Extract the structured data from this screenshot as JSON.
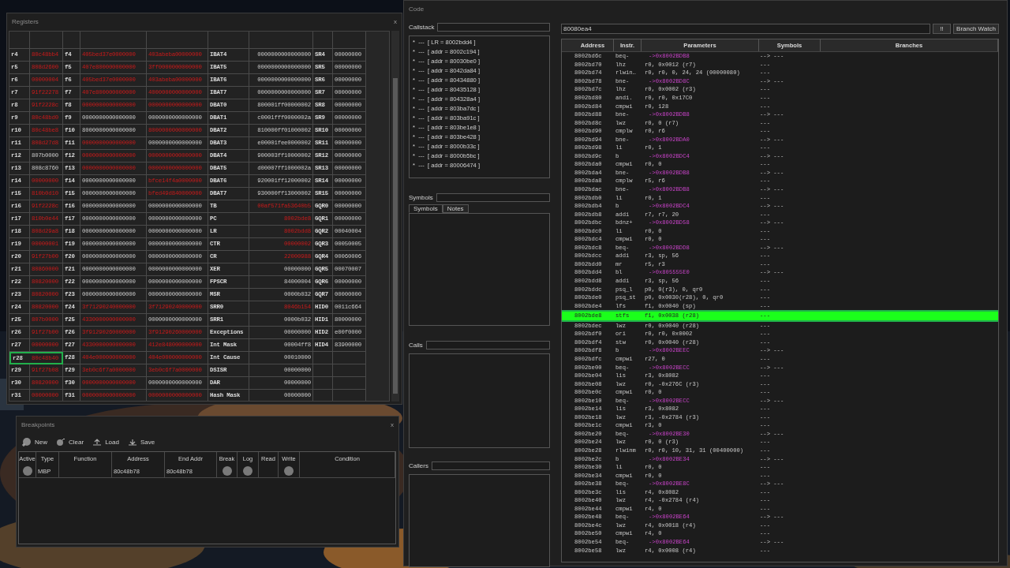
{
  "registers": {
    "title": "Registers",
    "close": "x",
    "rows": [
      {
        "selected": false,
        "cells": [
          {
            "kind": "name",
            "text": "r4"
          },
          {
            "kind": "value",
            "text": "80c48bb4",
            "changed": true
          },
          {
            "kind": "name",
            "text": "f4"
          },
          {
            "kind": "value",
            "text": "405bed37e0000000",
            "changed": true
          },
          {
            "kind": "value",
            "text": "403abeba00000000",
            "changed": true
          },
          {
            "kind": "name",
            "text": "IBAT4"
          },
          {
            "kind": "value",
            "text": "0000000000000000",
            "changed": false
          },
          {
            "kind": "name",
            "text": "SR4"
          },
          {
            "kind": "value",
            "text": "00000000",
            "changed": false
          }
        ]
      },
      {
        "selected": false,
        "cells": [
          {
            "kind": "name",
            "text": "r5"
          },
          {
            "kind": "value",
            "text": "808d2600",
            "changed": true
          },
          {
            "kind": "name",
            "text": "f5"
          },
          {
            "kind": "value",
            "text": "407e800000000000",
            "changed": true
          },
          {
            "kind": "value",
            "text": "3ff0000000000000",
            "changed": true
          },
          {
            "kind": "name",
            "text": "IBAT5"
          },
          {
            "kind": "value",
            "text": "0000000000000000",
            "changed": false
          },
          {
            "kind": "name",
            "text": "SR5"
          },
          {
            "kind": "value",
            "text": "00000000",
            "changed": false
          }
        ]
      },
      {
        "selected": false,
        "cells": [
          {
            "kind": "name",
            "text": "r6"
          },
          {
            "kind": "value",
            "text": "00000004",
            "changed": true
          },
          {
            "kind": "name",
            "text": "f6"
          },
          {
            "kind": "value",
            "text": "405bed37e0000000",
            "changed": true
          },
          {
            "kind": "value",
            "text": "403abeba00000000",
            "changed": true
          },
          {
            "kind": "name",
            "text": "IBAT6"
          },
          {
            "kind": "value",
            "text": "0000000000000000",
            "changed": false
          },
          {
            "kind": "name",
            "text": "SR6"
          },
          {
            "kind": "value",
            "text": "00000000",
            "changed": false
          }
        ]
      },
      {
        "selected": false,
        "cells": [
          {
            "kind": "name",
            "text": "r7"
          },
          {
            "kind": "value",
            "text": "91f22278",
            "changed": true
          },
          {
            "kind": "name",
            "text": "f7"
          },
          {
            "kind": "value",
            "text": "407e800000000000",
            "changed": true
          },
          {
            "kind": "value",
            "text": "4000000000000000",
            "changed": true
          },
          {
            "kind": "name",
            "text": "IBAT7"
          },
          {
            "kind": "value",
            "text": "0000000000000000",
            "changed": false
          },
          {
            "kind": "name",
            "text": "SR7"
          },
          {
            "kind": "value",
            "text": "00000000",
            "changed": false
          }
        ]
      },
      {
        "selected": false,
        "cells": [
          {
            "kind": "name",
            "text": "r8"
          },
          {
            "kind": "value",
            "text": "91f2228c",
            "changed": true
          },
          {
            "kind": "name",
            "text": "f8"
          },
          {
            "kind": "value",
            "text": "0000000000000000",
            "changed": true
          },
          {
            "kind": "value",
            "text": "0000000000000000",
            "changed": true
          },
          {
            "kind": "name",
            "text": "DBAT0"
          },
          {
            "kind": "value",
            "text": "800001ff00000002",
            "changed": false
          },
          {
            "kind": "name",
            "text": "SR8"
          },
          {
            "kind": "value",
            "text": "00000000",
            "changed": false
          }
        ]
      },
      {
        "selected": false,
        "cells": [
          {
            "kind": "name",
            "text": "r9"
          },
          {
            "kind": "value",
            "text": "80c48bd0",
            "changed": true
          },
          {
            "kind": "name",
            "text": "f9"
          },
          {
            "kind": "value",
            "text": "0000000000000000",
            "changed": false
          },
          {
            "kind": "value",
            "text": "0000000000000000",
            "changed": false
          },
          {
            "kind": "name",
            "text": "DBAT1"
          },
          {
            "kind": "value",
            "text": "c0001fff0000002a",
            "changed": false
          },
          {
            "kind": "name",
            "text": "SR9"
          },
          {
            "kind": "value",
            "text": "00000000",
            "changed": false
          }
        ]
      },
      {
        "selected": false,
        "cells": [
          {
            "kind": "name",
            "text": "r10"
          },
          {
            "kind": "value",
            "text": "80c48be8",
            "changed": true
          },
          {
            "kind": "name",
            "text": "f10"
          },
          {
            "kind": "value",
            "text": "8000000000000000",
            "changed": false
          },
          {
            "kind": "value",
            "text": "8000000000000000",
            "changed": true
          },
          {
            "kind": "name",
            "text": "DBAT2"
          },
          {
            "kind": "value",
            "text": "810000ff01000002",
            "changed": false
          },
          {
            "kind": "name",
            "text": "SR10"
          },
          {
            "kind": "value",
            "text": "00000000",
            "changed": false
          }
        ]
      },
      {
        "selected": false,
        "cells": [
          {
            "kind": "name",
            "text": "r11"
          },
          {
            "kind": "value",
            "text": "808d27d8",
            "changed": true
          },
          {
            "kind": "name",
            "text": "f11"
          },
          {
            "kind": "value",
            "text": "0000000000000000",
            "changed": true
          },
          {
            "kind": "value",
            "text": "0000000000000000",
            "changed": false
          },
          {
            "kind": "name",
            "text": "DBAT3"
          },
          {
            "kind": "value",
            "text": "e00001fee0000002",
            "changed": false
          },
          {
            "kind": "name",
            "text": "SR11"
          },
          {
            "kind": "value",
            "text": "00000000",
            "changed": false
          }
        ]
      },
      {
        "selected": false,
        "cells": [
          {
            "kind": "name",
            "text": "r12"
          },
          {
            "kind": "value",
            "text": "807b0000",
            "changed": false
          },
          {
            "kind": "name",
            "text": "f12"
          },
          {
            "kind": "value",
            "text": "0000000000000000",
            "changed": true
          },
          {
            "kind": "value",
            "text": "0000000000000000",
            "changed": true
          },
          {
            "kind": "name",
            "text": "DBAT4"
          },
          {
            "kind": "value",
            "text": "900003ff10000002",
            "changed": false
          },
          {
            "kind": "name",
            "text": "SR12"
          },
          {
            "kind": "value",
            "text": "00000000",
            "changed": false
          }
        ]
      },
      {
        "selected": false,
        "cells": [
          {
            "kind": "name",
            "text": "r13"
          },
          {
            "kind": "value",
            "text": "808c8760",
            "changed": false
          },
          {
            "kind": "name",
            "text": "f13"
          },
          {
            "kind": "value",
            "text": "0000000000000000",
            "changed": true
          },
          {
            "kind": "value",
            "text": "0000000000000000",
            "changed": true
          },
          {
            "kind": "name",
            "text": "DBAT5"
          },
          {
            "kind": "value",
            "text": "d00007ff1000002a",
            "changed": false
          },
          {
            "kind": "name",
            "text": "SR13"
          },
          {
            "kind": "value",
            "text": "00000000",
            "changed": false
          }
        ]
      },
      {
        "selected": false,
        "cells": [
          {
            "kind": "name",
            "text": "r14"
          },
          {
            "kind": "value",
            "text": "00000000",
            "changed": true
          },
          {
            "kind": "name",
            "text": "f14"
          },
          {
            "kind": "value",
            "text": "0000000000000000",
            "changed": false
          },
          {
            "kind": "value",
            "text": "bfce14f4a0000000",
            "changed": true
          },
          {
            "kind": "name",
            "text": "DBAT6"
          },
          {
            "kind": "value",
            "text": "920001ff12000002",
            "changed": false
          },
          {
            "kind": "name",
            "text": "SR14"
          },
          {
            "kind": "value",
            "text": "00000000",
            "changed": false
          }
        ]
      },
      {
        "selected": false,
        "cells": [
          {
            "kind": "name",
            "text": "r15"
          },
          {
            "kind": "value",
            "text": "810b0d10",
            "changed": true
          },
          {
            "kind": "name",
            "text": "f15"
          },
          {
            "kind": "value",
            "text": "0000000000000000",
            "changed": false
          },
          {
            "kind": "value",
            "text": "bfed49d840000000",
            "changed": true
          },
          {
            "kind": "name",
            "text": "DBAT7"
          },
          {
            "kind": "value",
            "text": "930000ff13000002",
            "changed": false
          },
          {
            "kind": "name",
            "text": "SR15"
          },
          {
            "kind": "value",
            "text": "00000000",
            "changed": false
          }
        ]
      },
      {
        "selected": false,
        "cells": [
          {
            "kind": "name",
            "text": "r16"
          },
          {
            "kind": "value",
            "text": "91f2228c",
            "changed": true
          },
          {
            "kind": "name",
            "text": "f16"
          },
          {
            "kind": "value",
            "text": "0000000000000000",
            "changed": false
          },
          {
            "kind": "value",
            "text": "0000000000000000",
            "changed": false
          },
          {
            "kind": "name",
            "text": "TB"
          },
          {
            "kind": "value",
            "text": "00af571fa53640b5",
            "changed": true
          },
          {
            "kind": "name",
            "text": "GQR0"
          },
          {
            "kind": "value",
            "text": "00000000",
            "changed": false
          }
        ]
      },
      {
        "selected": false,
        "cells": [
          {
            "kind": "name",
            "text": "r17"
          },
          {
            "kind": "value",
            "text": "810b0e44",
            "changed": true
          },
          {
            "kind": "name",
            "text": "f17"
          },
          {
            "kind": "value",
            "text": "0000000000000000",
            "changed": false
          },
          {
            "kind": "value",
            "text": "0000000000000000",
            "changed": false
          },
          {
            "kind": "name",
            "text": "PC"
          },
          {
            "kind": "value",
            "text": "8002bde8",
            "changed": true
          },
          {
            "kind": "name",
            "text": "GQR1"
          },
          {
            "kind": "value",
            "text": "00000000",
            "changed": false
          }
        ]
      },
      {
        "selected": false,
        "cells": [
          {
            "kind": "name",
            "text": "r18"
          },
          {
            "kind": "value",
            "text": "808d29a8",
            "changed": true
          },
          {
            "kind": "name",
            "text": "f18"
          },
          {
            "kind": "value",
            "text": "0000000000000000",
            "changed": false
          },
          {
            "kind": "value",
            "text": "0000000000000000",
            "changed": false
          },
          {
            "kind": "name",
            "text": "LR"
          },
          {
            "kind": "value",
            "text": "8002bdd8",
            "changed": true
          },
          {
            "kind": "name",
            "text": "GQR2"
          },
          {
            "kind": "value",
            "text": "00040004",
            "changed": false
          }
        ]
      },
      {
        "selected": false,
        "cells": [
          {
            "kind": "name",
            "text": "r19"
          },
          {
            "kind": "value",
            "text": "00000001",
            "changed": true
          },
          {
            "kind": "name",
            "text": "f19"
          },
          {
            "kind": "value",
            "text": "0000000000000000",
            "changed": false
          },
          {
            "kind": "value",
            "text": "0000000000000000",
            "changed": false
          },
          {
            "kind": "name",
            "text": "CTR"
          },
          {
            "kind": "value",
            "text": "00000002",
            "changed": true
          },
          {
            "kind": "name",
            "text": "GQR3"
          },
          {
            "kind": "value",
            "text": "00050005",
            "changed": false
          }
        ]
      },
      {
        "selected": false,
        "cells": [
          {
            "kind": "name",
            "text": "r20"
          },
          {
            "kind": "value",
            "text": "91f27b00",
            "changed": true
          },
          {
            "kind": "name",
            "text": "f20"
          },
          {
            "kind": "value",
            "text": "0000000000000000",
            "changed": false
          },
          {
            "kind": "value",
            "text": "0000000000000000",
            "changed": false
          },
          {
            "kind": "name",
            "text": "CR"
          },
          {
            "kind": "value",
            "text": "22000988",
            "changed": true
          },
          {
            "kind": "name",
            "text": "GQR4"
          },
          {
            "kind": "value",
            "text": "00060006",
            "changed": false
          }
        ]
      },
      {
        "selected": false,
        "cells": [
          {
            "kind": "name",
            "text": "r21"
          },
          {
            "kind": "value",
            "text": "80860000",
            "changed": true
          },
          {
            "kind": "name",
            "text": "f21"
          },
          {
            "kind": "value",
            "text": "0000000000000000",
            "changed": false
          },
          {
            "kind": "value",
            "text": "0000000000000000",
            "changed": false
          },
          {
            "kind": "name",
            "text": "XER"
          },
          {
            "kind": "value",
            "text": "00000000",
            "changed": false
          },
          {
            "kind": "name",
            "text": "GQR5"
          },
          {
            "kind": "value",
            "text": "00070007",
            "changed": false
          }
        ]
      },
      {
        "selected": false,
        "cells": [
          {
            "kind": "name",
            "text": "r22"
          },
          {
            "kind": "value",
            "text": "80820000",
            "changed": true
          },
          {
            "kind": "name",
            "text": "f22"
          },
          {
            "kind": "value",
            "text": "0000000000000000",
            "changed": false
          },
          {
            "kind": "value",
            "text": "0000000000000000",
            "changed": false
          },
          {
            "kind": "name",
            "text": "FPSCR"
          },
          {
            "kind": "value",
            "text": "84000004",
            "changed": false
          },
          {
            "kind": "name",
            "text": "GQR6"
          },
          {
            "kind": "value",
            "text": "00000000",
            "changed": false
          }
        ]
      },
      {
        "selected": false,
        "cells": [
          {
            "kind": "name",
            "text": "r23"
          },
          {
            "kind": "value",
            "text": "80820000",
            "changed": true
          },
          {
            "kind": "name",
            "text": "f23"
          },
          {
            "kind": "value",
            "text": "0000000000000000",
            "changed": false
          },
          {
            "kind": "value",
            "text": "0000000000000000",
            "changed": false
          },
          {
            "kind": "name",
            "text": "MSR"
          },
          {
            "kind": "value",
            "text": "0000b032",
            "changed": false
          },
          {
            "kind": "name",
            "text": "GQR7"
          },
          {
            "kind": "value",
            "text": "00000000",
            "changed": false
          }
        ]
      },
      {
        "selected": false,
        "cells": [
          {
            "kind": "name",
            "text": "r24"
          },
          {
            "kind": "value",
            "text": "80820000",
            "changed": true
          },
          {
            "kind": "name",
            "text": "f24"
          },
          {
            "kind": "value",
            "text": "3f71290240000000",
            "changed": true
          },
          {
            "kind": "value",
            "text": "3f71290240000000",
            "changed": true
          },
          {
            "kind": "name",
            "text": "SRR0"
          },
          {
            "kind": "value",
            "text": "8046b154",
            "changed": true
          },
          {
            "kind": "name",
            "text": "HID0"
          },
          {
            "kind": "value",
            "text": "0011c664",
            "changed": false
          }
        ]
      },
      {
        "selected": false,
        "cells": [
          {
            "kind": "name",
            "text": "r25"
          },
          {
            "kind": "value",
            "text": "807b0000",
            "changed": true
          },
          {
            "kind": "name",
            "text": "f25"
          },
          {
            "kind": "value",
            "text": "4330000000000000",
            "changed": true
          },
          {
            "kind": "value",
            "text": "0000000000000000",
            "changed": false
          },
          {
            "kind": "name",
            "text": "SRR1"
          },
          {
            "kind": "value",
            "text": "0000b032",
            "changed": false
          },
          {
            "kind": "name",
            "text": "HID1"
          },
          {
            "kind": "value",
            "text": "80000000",
            "changed": false
          }
        ]
      },
      {
        "selected": false,
        "cells": [
          {
            "kind": "name",
            "text": "r26"
          },
          {
            "kind": "value",
            "text": "91f27b00",
            "changed": true
          },
          {
            "kind": "name",
            "text": "f26"
          },
          {
            "kind": "value",
            "text": "3f91290260000000",
            "changed": true
          },
          {
            "kind": "value",
            "text": "3f91290260000000",
            "changed": true
          },
          {
            "kind": "name",
            "text": "Exceptions"
          },
          {
            "kind": "value",
            "text": "00000000",
            "changed": false
          },
          {
            "kind": "name",
            "text": "HID2"
          },
          {
            "kind": "value",
            "text": "e00f0000",
            "changed": false
          }
        ]
      },
      {
        "selected": false,
        "cells": [
          {
            "kind": "name",
            "text": "r27"
          },
          {
            "kind": "value",
            "text": "00000000",
            "changed": true
          },
          {
            "kind": "name",
            "text": "f27"
          },
          {
            "kind": "value",
            "text": "4330000000000000",
            "changed": true
          },
          {
            "kind": "value",
            "text": "412e848000000000",
            "changed": true
          },
          {
            "kind": "name",
            "text": "Int Mask"
          },
          {
            "kind": "value",
            "text": "00004ff8",
            "changed": false
          },
          {
            "kind": "name",
            "text": "HID4"
          },
          {
            "kind": "value",
            "text": "83900000",
            "changed": false
          }
        ]
      },
      {
        "selected": true,
        "cells": [
          {
            "kind": "name",
            "text": "r28"
          },
          {
            "kind": "value",
            "text": "80c48b40",
            "changed": true
          },
          {
            "kind": "name",
            "text": "f28"
          },
          {
            "kind": "value",
            "text": "404e000000000000",
            "changed": true
          },
          {
            "kind": "value",
            "text": "404e000000000000",
            "changed": true
          },
          {
            "kind": "name",
            "text": "Int Cause"
          },
          {
            "kind": "value",
            "text": "00010000",
            "changed": false
          }
        ]
      },
      {
        "selected": false,
        "cells": [
          {
            "kind": "name",
            "text": "r29"
          },
          {
            "kind": "value",
            "text": "91f27b08",
            "changed": true
          },
          {
            "kind": "name",
            "text": "f29"
          },
          {
            "kind": "value",
            "text": "3eb0c6f7a0000000",
            "changed": true
          },
          {
            "kind": "value",
            "text": "3eb0c6f7a0000000",
            "changed": true
          },
          {
            "kind": "name",
            "text": "DSISR"
          },
          {
            "kind": "value",
            "text": "00000000",
            "changed": false
          }
        ]
      },
      {
        "selected": false,
        "cells": [
          {
            "kind": "name",
            "text": "r30"
          },
          {
            "kind": "value",
            "text": "80820000",
            "changed": true
          },
          {
            "kind": "name",
            "text": "f30"
          },
          {
            "kind": "value",
            "text": "0000000000000000",
            "changed": true
          },
          {
            "kind": "value",
            "text": "0000000000000000",
            "changed": false
          },
          {
            "kind": "name",
            "text": "DAR"
          },
          {
            "kind": "value",
            "text": "00000000",
            "changed": false
          }
        ]
      },
      {
        "selected": false,
        "cells": [
          {
            "kind": "name",
            "text": "r31"
          },
          {
            "kind": "value",
            "text": "00000000",
            "changed": true
          },
          {
            "kind": "name",
            "text": "f31"
          },
          {
            "kind": "value",
            "text": "0000000000000000",
            "changed": true
          },
          {
            "kind": "value",
            "text": "0000000000000000",
            "changed": true
          },
          {
            "kind": "name",
            "text": "Hash Mask"
          },
          {
            "kind": "value",
            "text": "00000000",
            "changed": false
          }
        ]
      }
    ]
  },
  "breakpoints": {
    "title": "Breakpoints",
    "close": "x",
    "toolbar": [
      {
        "kind": "new",
        "label": "New"
      },
      {
        "kind": "clear",
        "label": "Clear"
      },
      {
        "kind": "load",
        "label": "Load"
      },
      {
        "kind": "save",
        "label": "Save"
      }
    ],
    "columns": [
      "Active",
      "Type",
      "Function",
      "Address",
      "End Addr",
      "Break",
      "Log",
      "Read",
      "Write",
      "Condition"
    ],
    "rows": [
      {
        "active": true,
        "type": "MBP",
        "address": "80c48b78",
        "end_addr": "80c48b78",
        "break": true,
        "log": true,
        "read": false,
        "write": true
      }
    ]
  },
  "code": {
    "title": "Code",
    "callstack": {
      "label": "Callstack",
      "items": [
        "*  ---  [ LR = 8002bdd4 ]",
        "*  ---  [ addr = 8002c194 ]",
        "*  ---  [ addr = 80030be0 ]",
        "*  ---  [ addr = 8042da84 ]",
        "*  ---  [ addr = 80434880 ]",
        "*  ---  [ addr = 80435128 ]",
        "*  ---  [ addr = 804328a4 ]",
        "*  ---  [ addr = 803ba7dc ]",
        "*  ---  [ addr = 803ba91c ]",
        "*  ---  [ addr = 803be1e8 ]",
        "*  ---  [ addr = 803be428 ]",
        "*  ---  [ addr = 8000b33c ]",
        "*  ---  [ addr = 8000b5bc ]",
        "*  ---  [ addr = 80006474 ]"
      ]
    },
    "symbols": {
      "label": "Symbols",
      "tabs": [
        {
          "label": "Symbols",
          "selected": true
        },
        {
          "label": "Notes",
          "selected": false
        }
      ]
    },
    "calls": {
      "label": "Calls"
    },
    "callers": {
      "label": "Callers"
    },
    "address": {
      "value": "80080ea4"
    },
    "buttons": [
      "!!",
      "Branch Watch"
    ],
    "columns": [
      "Address",
      "Instr.",
      "Parameters",
      "Symbols",
      "Branches"
    ],
    "rows": [
      {
        "address": "8002bd6c",
        "instr": "beq-",
        "params": "->0x8002BDB8",
        "kind": "branch",
        "symbol": "--> ---",
        "selected": false
      },
      {
        "address": "8002bd70",
        "instr": "lhz",
        "params": "r0, 0x0012 (r7)",
        "kind": "op",
        "symbol": "---",
        "selected": false
      },
      {
        "address": "8002bd74",
        "instr": "rlwin…",
        "params": "r0, r0, 0, 24, 24 (00000080)",
        "kind": "op",
        "symbol": "---",
        "selected": false
      },
      {
        "address": "8002bd78",
        "instr": "bne-",
        "params": "->0x8002BD8C",
        "kind": "branch",
        "symbol": "--> ---",
        "selected": false
      },
      {
        "address": "8002bd7c",
        "instr": "lhz",
        "params": "r0, 0x0002 (r3)",
        "kind": "op",
        "symbol": "---",
        "selected": false
      },
      {
        "address": "8002bd80",
        "instr": "andi.",
        "params": "r0, r0, 0x17C0",
        "kind": "op",
        "symbol": "---",
        "selected": false
      },
      {
        "address": "8002bd84",
        "instr": "cmpwi",
        "params": "r0, 128",
        "kind": "op",
        "symbol": "---",
        "selected": false
      },
      {
        "address": "8002bd88",
        "instr": "bne-",
        "params": "->0x8002BDB8",
        "kind": "branch",
        "symbol": "--> ---",
        "selected": false
      },
      {
        "address": "8002bd8c",
        "instr": "lwz",
        "params": "r0, 0 (r7)",
        "kind": "op",
        "symbol": "---",
        "selected": false
      },
      {
        "address": "8002bd90",
        "instr": "cmplw",
        "params": "r0, r6",
        "kind": "op",
        "symbol": "---",
        "selected": false
      },
      {
        "address": "8002bd94",
        "instr": "bne-",
        "params": "->0x8002BDA0",
        "kind": "branch",
        "symbol": "--> ---",
        "selected": false
      },
      {
        "address": "8002bd98",
        "instr": "li",
        "params": "r0, 1",
        "kind": "op",
        "symbol": "---",
        "selected": false
      },
      {
        "address": "8002bd9c",
        "instr": "b",
        "params": "->0x8002BDC4",
        "kind": "branch",
        "symbol": "--> ---",
        "selected": false
      },
      {
        "address": "8002bda0",
        "instr": "cmpwi",
        "params": "r0, 0",
        "kind": "op",
        "symbol": "---",
        "selected": false
      },
      {
        "address": "8002bda4",
        "instr": "bne-",
        "params": "->0x8002BDB8",
        "kind": "branch",
        "symbol": "--> ---",
        "selected": false
      },
      {
        "address": "8002bda8",
        "instr": "cmplw",
        "params": "r5, r6",
        "kind": "op",
        "symbol": "---",
        "selected": false
      },
      {
        "address": "8002bdac",
        "instr": "bne-",
        "params": "->0x8002BDB8",
        "kind": "branch",
        "symbol": "--> ---",
        "selected": false
      },
      {
        "address": "8002bdb0",
        "instr": "li",
        "params": "r0, 1",
        "kind": "op",
        "symbol": "---",
        "selected": false
      },
      {
        "address": "8002bdb4",
        "instr": "b",
        "params": "->0x8002BDC4",
        "kind": "branch",
        "symbol": "--> ---",
        "selected": false
      },
      {
        "address": "8002bdb8",
        "instr": "addi",
        "params": "r7, r7, 20",
        "kind": "op",
        "symbol": "---",
        "selected": false
      },
      {
        "address": "8002bdbc",
        "instr": "bdnz+",
        "params": "->0x8002BD58",
        "kind": "branch",
        "symbol": "--> ---",
        "selected": false
      },
      {
        "address": "8002bdc0",
        "instr": "li",
        "params": "r0, 0",
        "kind": "op",
        "symbol": "---",
        "selected": false
      },
      {
        "address": "8002bdc4",
        "instr": "cmpwi",
        "params": "r0, 0",
        "kind": "op",
        "symbol": "---",
        "selected": false
      },
      {
        "address": "8002bdc8",
        "instr": "beq-",
        "params": "->0x8002BDD8",
        "kind": "branch",
        "symbol": "--> ---",
        "selected": false
      },
      {
        "address": "8002bdcc",
        "instr": "addi",
        "params": "r3, sp, 56",
        "kind": "op",
        "symbol": "---",
        "selected": false
      },
      {
        "address": "8002bdd0",
        "instr": "mr",
        "params": "r5, r3",
        "kind": "op",
        "symbol": "---",
        "selected": false
      },
      {
        "address": "8002bdd4",
        "instr": "bl",
        "params": "->0x805555E0",
        "kind": "branch",
        "symbol": "--> ---",
        "selected": false
      },
      {
        "address": "8002bdd8",
        "instr": "addi",
        "params": "r3, sp, 56",
        "kind": "op",
        "symbol": "---",
        "selected": false
      },
      {
        "address": "8002bddc",
        "instr": "psq_l",
        "params": "p0, 0(r3), 0, qr0",
        "kind": "op",
        "symbol": "---",
        "selected": false
      },
      {
        "address": "8002bde0",
        "instr": "psq_st",
        "params": "p0, 0x0030(r28), 0, qr0",
        "kind": "op",
        "symbol": "---",
        "selected": false
      },
      {
        "address": "8002bde4",
        "instr": "lfs",
        "params": "f1, 0x0040 (sp)",
        "kind": "op",
        "symbol": "---",
        "selected": false
      },
      {
        "address": "8002bde8",
        "instr": "stfs",
        "params": "f1, 0x0038 (r28)",
        "kind": "op",
        "symbol": "---",
        "selected": true
      },
      {
        "address": "8002bdec",
        "instr": "lwz",
        "params": "r0, 0x0040 (r28)",
        "kind": "op",
        "symbol": "---",
        "selected": false
      },
      {
        "address": "8002bdf0",
        "instr": "ori",
        "params": "r0, r0, 0x0002",
        "kind": "op",
        "symbol": "---",
        "selected": false
      },
      {
        "address": "8002bdf4",
        "instr": "stw",
        "params": "r0, 0x0040 (r28)",
        "kind": "op",
        "symbol": "---",
        "selected": false
      },
      {
        "address": "8002bdf8",
        "instr": "b",
        "params": "->0x8002BEEC",
        "kind": "branch",
        "symbol": "--> ---",
        "selected": false
      },
      {
        "address": "8002bdfc",
        "instr": "cmpwi",
        "params": "r27, 0",
        "kind": "op",
        "symbol": "---",
        "selected": false
      },
      {
        "address": "8002be00",
        "instr": "beq-",
        "params": "->0x8002BECC",
        "kind": "branch",
        "symbol": "--> ---",
        "selected": false
      },
      {
        "address": "8002be04",
        "instr": "lis",
        "params": "r3, 0x8082",
        "kind": "op",
        "symbol": "---",
        "selected": false
      },
      {
        "address": "8002be08",
        "instr": "lwz",
        "params": "r0, -0x276C (r3)",
        "kind": "op",
        "symbol": "---",
        "selected": false
      },
      {
        "address": "8002be0c",
        "instr": "cmpwi",
        "params": "r0, 0",
        "kind": "op",
        "symbol": "---",
        "selected": false
      },
      {
        "address": "8002be10",
        "instr": "beq-",
        "params": "->0x8002BECC",
        "kind": "branch",
        "symbol": "--> ---",
        "selected": false
      },
      {
        "address": "8002be14",
        "instr": "lis",
        "params": "r3, 0x8082",
        "kind": "op",
        "symbol": "---",
        "selected": false
      },
      {
        "address": "8002be18",
        "instr": "lwz",
        "params": "r3, -0x2784 (r3)",
        "kind": "op",
        "symbol": "---",
        "selected": false
      },
      {
        "address": "8002be1c",
        "instr": "cmpwi",
        "params": "r3, 0",
        "kind": "op",
        "symbol": "---",
        "selected": false
      },
      {
        "address": "8002be20",
        "instr": "beq-",
        "params": "->0x8002BE30",
        "kind": "branch",
        "symbol": "--> ---",
        "selected": false
      },
      {
        "address": "8002be24",
        "instr": "lwz",
        "params": "r0, 0 (r3)",
        "kind": "op",
        "symbol": "---",
        "selected": false
      },
      {
        "address": "8002be28",
        "instr": "rlwinm",
        "params": "r0, r0, 10, 31, 31 (00400000)",
        "kind": "op",
        "symbol": "---",
        "selected": false
      },
      {
        "address": "8002be2c",
        "instr": "b",
        "params": "->0x8002BE34",
        "kind": "branch",
        "symbol": "--> ---",
        "selected": false
      },
      {
        "address": "8002be30",
        "instr": "li",
        "params": "r0, 0",
        "kind": "op",
        "symbol": "---",
        "selected": false
      },
      {
        "address": "8002be34",
        "instr": "cmpwi",
        "params": "r0, 0",
        "kind": "op",
        "symbol": "---",
        "selected": false
      },
      {
        "address": "8002be38",
        "instr": "beq-",
        "params": "->0x8002BE8C",
        "kind": "branch",
        "symbol": "--> ---",
        "selected": false
      },
      {
        "address": "8002be3c",
        "instr": "lis",
        "params": "r4, 0x8082",
        "kind": "op",
        "symbol": "---",
        "selected": false
      },
      {
        "address": "8002be40",
        "instr": "lwz",
        "params": "r4, -0x2784 (r4)",
        "kind": "op",
        "symbol": "---",
        "selected": false
      },
      {
        "address": "8002be44",
        "instr": "cmpwi",
        "params": "r4, 0",
        "kind": "op",
        "symbol": "---",
        "selected": false
      },
      {
        "address": "8002be48",
        "instr": "beq-",
        "params": "->0x8002BE64",
        "kind": "branch",
        "symbol": "--> ---",
        "selected": false
      },
      {
        "address": "8002be4c",
        "instr": "lwz",
        "params": "r4, 0x0018 (r4)",
        "kind": "op",
        "symbol": "---",
        "selected": false
      },
      {
        "address": "8002be50",
        "instr": "cmpwi",
        "params": "r4, 0",
        "kind": "op",
        "symbol": "---",
        "selected": false
      },
      {
        "address": "8002be54",
        "instr": "beq-",
        "params": "->0x8002BE64",
        "kind": "branch",
        "symbol": "--> ---",
        "selected": false
      },
      {
        "address": "8002be58",
        "instr": "lwz",
        "params": "r4, 0x0008 (r4)",
        "kind": "op",
        "symbol": "---",
        "selected": false
      }
    ]
  }
}
